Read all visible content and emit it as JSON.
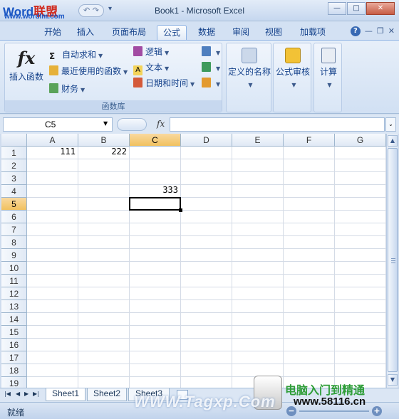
{
  "watermark": {
    "logo_word": "Word",
    "logo_cn": "联盟",
    "url": "www.wordlm.com",
    "bottom_left": "WWW.Tagxp.Com",
    "bottom_right_cn": "电脑入门到精通",
    "bottom_right_url": "www.58116.cn"
  },
  "titlebar": {
    "title": "Book1 - Microsoft Excel",
    "minimize": "—",
    "maximize": "□",
    "close": "✕"
  },
  "tabs": [
    {
      "label": "开始"
    },
    {
      "label": "插入"
    },
    {
      "label": "页面布局"
    },
    {
      "label": "公式"
    },
    {
      "label": "数据"
    },
    {
      "label": "审阅"
    },
    {
      "label": "视图"
    },
    {
      "label": "加载项"
    }
  ],
  "ribbon": {
    "insert_function": "插入函数",
    "autosum": "自动求和",
    "recent": "最近使用的函数",
    "financial": "财务",
    "logical": "逻辑",
    "text": "文本",
    "datetime": "日期和时间",
    "group_function_library": "函数库",
    "defined_names": "定义的名称",
    "formula_auditing": "公式审核",
    "calculation": "计算"
  },
  "formula_bar": {
    "name_box": "C5",
    "fx": "fx",
    "formula": ""
  },
  "grid": {
    "columns": [
      "A",
      "B",
      "C",
      "D",
      "E",
      "F",
      "G"
    ],
    "rows": [
      "1",
      "2",
      "3",
      "4",
      "5",
      "6",
      "7",
      "8",
      "9",
      "10",
      "11",
      "12",
      "13",
      "14",
      "15",
      "16",
      "17",
      "18",
      "19"
    ],
    "cells": {
      "A1": "111",
      "B1": "222",
      "C4": "333"
    },
    "selected": "C5"
  },
  "sheets": [
    {
      "label": "Sheet1"
    },
    {
      "label": "Sheet2"
    },
    {
      "label": "Sheet3"
    }
  ],
  "status": {
    "text": "就绪"
  }
}
